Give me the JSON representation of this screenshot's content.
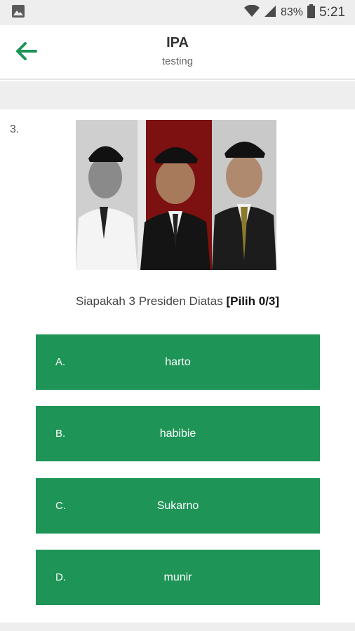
{
  "status_bar": {
    "battery_percent": "83%",
    "time": "5:21",
    "icons": [
      "image-notification-icon",
      "wifi-icon",
      "cellular-signal-icon",
      "battery-icon"
    ]
  },
  "app_bar": {
    "title": "IPA",
    "subtitle": "testing",
    "back_icon": "arrow-back-icon",
    "accent_color": "#1e9457"
  },
  "question": {
    "number": "3.",
    "text": "Siapakah 3 Presiden Diatas",
    "pick_label": "[Pilih 0/3]",
    "selected": 0,
    "max_select": 3
  },
  "options": [
    {
      "letter": "A.",
      "text": "harto"
    },
    {
      "letter": "B.",
      "text": "habibie"
    },
    {
      "letter": "C.",
      "text": "Sukarno"
    },
    {
      "letter": "D.",
      "text": "munir"
    }
  ],
  "colors": {
    "option_bg": "#1e9457",
    "status_bg": "#eeeeee"
  }
}
